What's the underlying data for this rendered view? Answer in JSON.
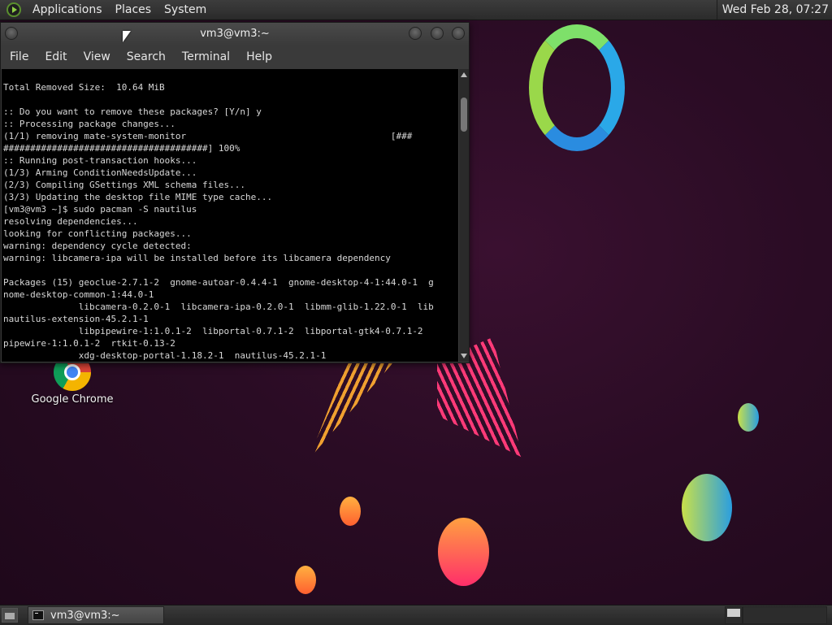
{
  "top_panel": {
    "menus": [
      "Applications",
      "Places",
      "System"
    ],
    "clock": "Wed Feb 28, 07:27"
  },
  "desktop": {
    "icons": [
      {
        "label": "Google Chrome",
        "icon": "chrome-icon"
      }
    ]
  },
  "terminal": {
    "title": "vm3@vm3:~",
    "menu": [
      "File",
      "Edit",
      "View",
      "Search",
      "Terminal",
      "Help"
    ],
    "lines": [
      "Total Removed Size:  10.64 MiB",
      "",
      ":: Do you want to remove these packages? [Y/n] y",
      ":: Processing package changes...",
      "(1/1) removing mate-system-monitor                                      [###",
      "######################################] 100%",
      ":: Running post-transaction hooks...",
      "(1/3) Arming ConditionNeedsUpdate...",
      "(2/3) Compiling GSettings XML schema files...",
      "(3/3) Updating the desktop file MIME type cache...",
      "[vm3@vm3 ~]$ sudo pacman -S nautilus",
      "resolving dependencies...",
      "looking for conflicting packages...",
      "warning: dependency cycle detected:",
      "warning: libcamera-ipa will be installed before its libcamera dependency",
      "",
      "Packages (15) geoclue-2.7.1-2  gnome-autoar-0.4.4-1  gnome-desktop-4-1:44.0-1  g",
      "nome-desktop-common-1:44.0-1",
      "              libcamera-0.2.0-1  libcamera-ipa-0.2.0-1  libmm-glib-1.22.0-1  lib",
      "nautilus-extension-45.2.1-1",
      "              libpipewire-1:1.0.1-2  libportal-0.7.1-2  libportal-gtk4-0.7.1-2",
      "pipewire-1:1.0.1-2  rtkit-0.13-2",
      "              xdg-desktop-portal-1.18.2-1  nautilus-45.2.1-1"
    ]
  },
  "taskbar": {
    "items": [
      {
        "label": "vm3@vm3:~",
        "icon": "terminal-icon"
      }
    ]
  },
  "colors": {
    "desktop_bg": "#2a0c24",
    "panel_bg": "#2b2b2b",
    "terminal_bg": "#000000",
    "terminal_fg": "#d8d8d8"
  }
}
